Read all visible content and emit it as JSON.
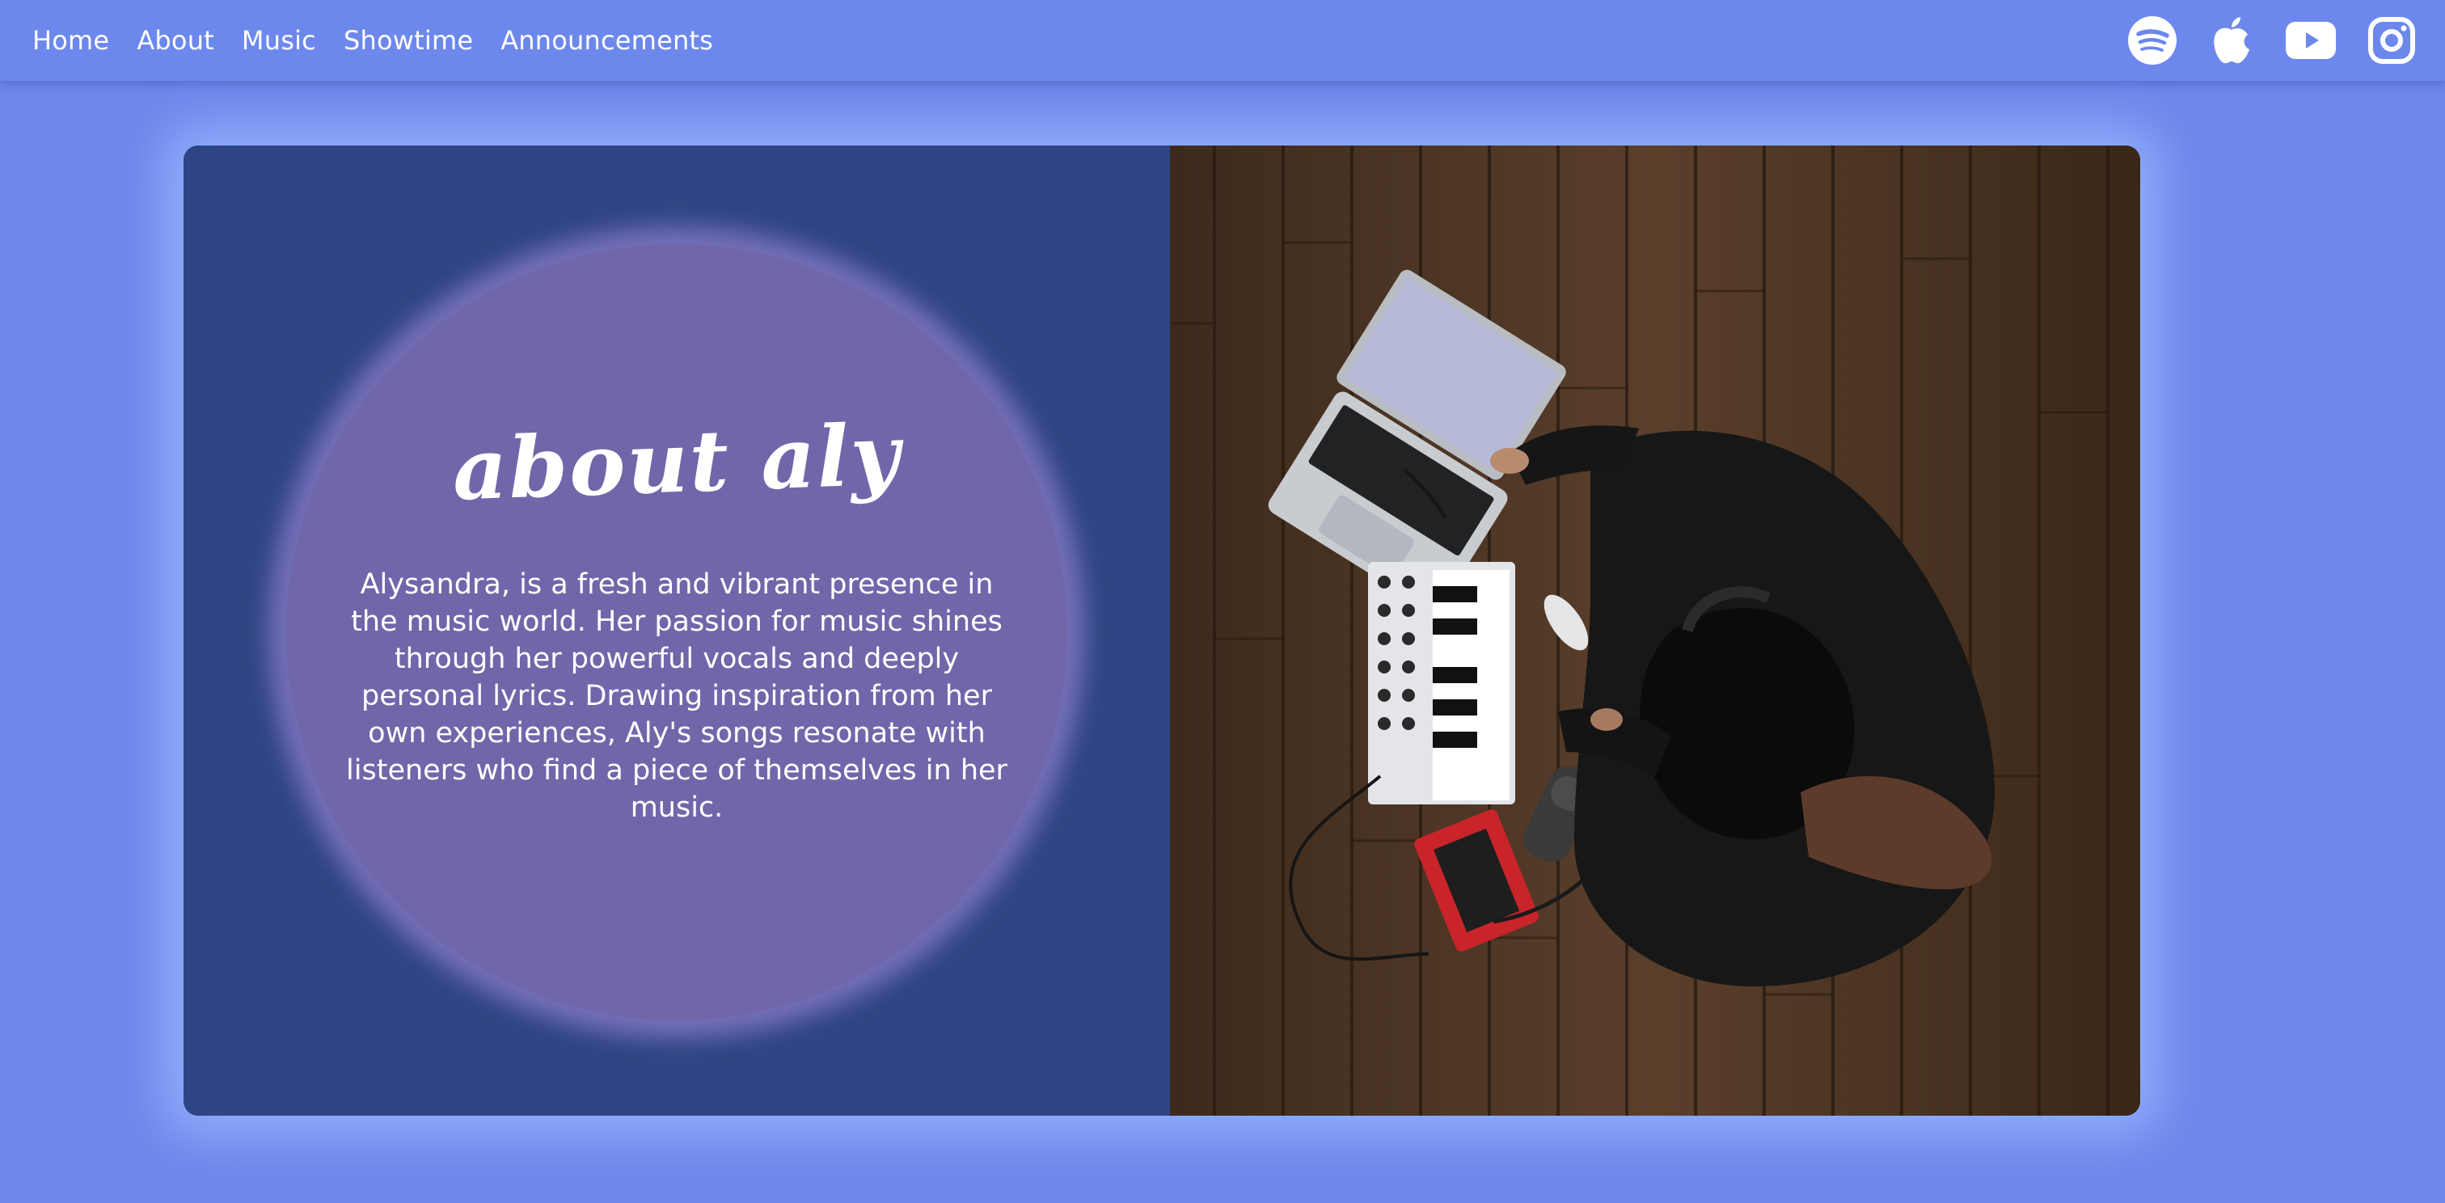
{
  "nav": {
    "links": [
      "Home",
      "About",
      "Music",
      "Showtime",
      "Announcements"
    ]
  },
  "social": {
    "icons": [
      "spotify-icon",
      "apple-music-icon",
      "youtube-icon",
      "instagram-icon"
    ]
  },
  "about": {
    "title": "about aly",
    "body": "Alysandra, is a fresh and vibrant presence in the music world. Her passion for music shines through her powerful vocals and deeply personal lyrics. Drawing inspiration from her own experiences, Aly's songs resonate with listeners who find a piece of themselves in her music."
  },
  "photo": {
    "subject": "music-studio-photo"
  },
  "colors": {
    "background": "#6d87ea",
    "card_left": "#2f4583",
    "blob": "#7067aa",
    "text": "#ffffff",
    "floor": "#4a3322"
  }
}
